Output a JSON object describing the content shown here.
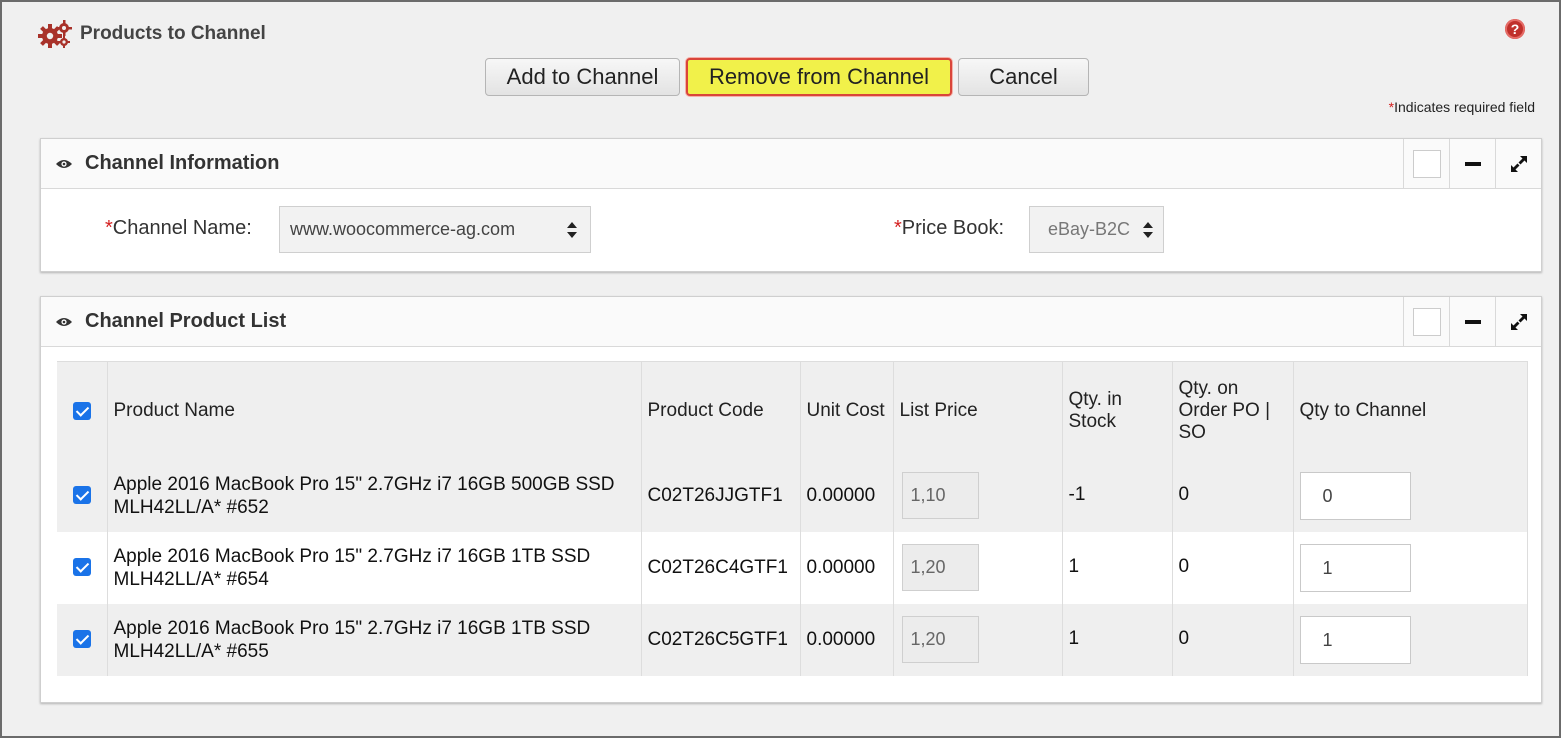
{
  "header": {
    "title": "Products to Channel",
    "help_icon": "question-icon"
  },
  "toolbar": {
    "add_label": "Add to Channel",
    "remove_label": "Remove from Channel",
    "cancel_label": "Cancel"
  },
  "required_note": {
    "star": "*",
    "text": "Indicates required field"
  },
  "channel_info": {
    "title": "Channel Information",
    "channel_name_label": "Channel Name:",
    "channel_name_value": "www.woocommerce-ag.com",
    "price_book_label": "Price Book:",
    "price_book_value": "eBay-B2C",
    "required_star": "*"
  },
  "product_list": {
    "title": "Channel Product List",
    "columns": {
      "product_name": "Product Name",
      "product_code": "Product Code",
      "unit_cost": "Unit Cost",
      "list_price": "List Price",
      "qty_in_stock": "Qty. in Stock",
      "qty_on_order": "Qty. on Order PO | SO",
      "qty_to_channel": "Qty to Channel"
    },
    "rows": [
      {
        "name": "Apple 2016 MacBook Pro 15\" 2.7GHz i7 16GB 500GB SSD MLH42LL/A* #652",
        "code": "C02T26JJGTF1",
        "unit_cost": "0.00000",
        "list_price": "1,10",
        "qty_in_stock": "-1",
        "qty_on_order": "0",
        "qty_to_channel": "0"
      },
      {
        "name": "Apple 2016 MacBook Pro 15\" 2.7GHz i7 16GB 1TB SSD MLH42LL/A* #654",
        "code": "C02T26C4GTF1",
        "unit_cost": "0.00000",
        "list_price": "1,20",
        "qty_in_stock": "1",
        "qty_on_order": "0",
        "qty_to_channel": "1"
      },
      {
        "name": "Apple 2016 MacBook Pro 15\" 2.7GHz i7 16GB 1TB SSD MLH42LL/A* #655",
        "code": "C02T26C5GTF1",
        "unit_cost": "0.00000",
        "list_price": "1,20",
        "qty_in_stock": "1",
        "qty_on_order": "0",
        "qty_to_channel": "1"
      }
    ]
  },
  "colors": {
    "highlight_button": "#f1f14a",
    "highlight_border": "#d9453a",
    "checkbox": "#1a73e8",
    "required": "#d42020"
  }
}
